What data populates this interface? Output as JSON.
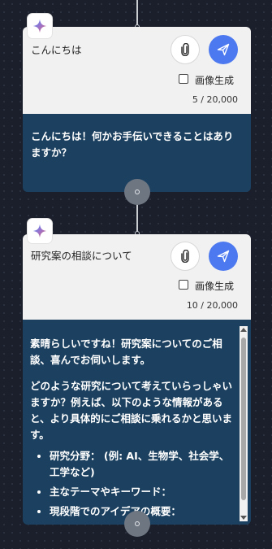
{
  "node1": {
    "prompt": "こんにちは",
    "image_gen_label": "画像生成",
    "counter": "5 / 20,000",
    "response": "こんにちは！何かお手伝いできることはありますか？"
  },
  "node2": {
    "prompt": "研究案の相談について",
    "image_gen_label": "画像生成",
    "counter": "10 / 20,000",
    "response_p1": "素晴らしいですね！研究案についてのご相談、喜んでお伺いします。",
    "response_p2": "どのような研究について考えていらっしゃいますか？例えば、以下のような情報があると、より具体的にご相談に乗れるかと思います。",
    "bullets": [
      "研究分野： (例: AI、生物学、社会学、工学など)",
      "主なテーマやキーワード：",
      "現段階でのアイデアの概要："
    ]
  },
  "icons": {
    "logo": "sparkle-icon",
    "attach": "paperclip-icon",
    "send": "send-icon"
  },
  "colors": {
    "background": "#1a1f2b",
    "card_input": "#f1f1f1",
    "card_response": "#1c4160",
    "send_button": "#4c79f0"
  }
}
